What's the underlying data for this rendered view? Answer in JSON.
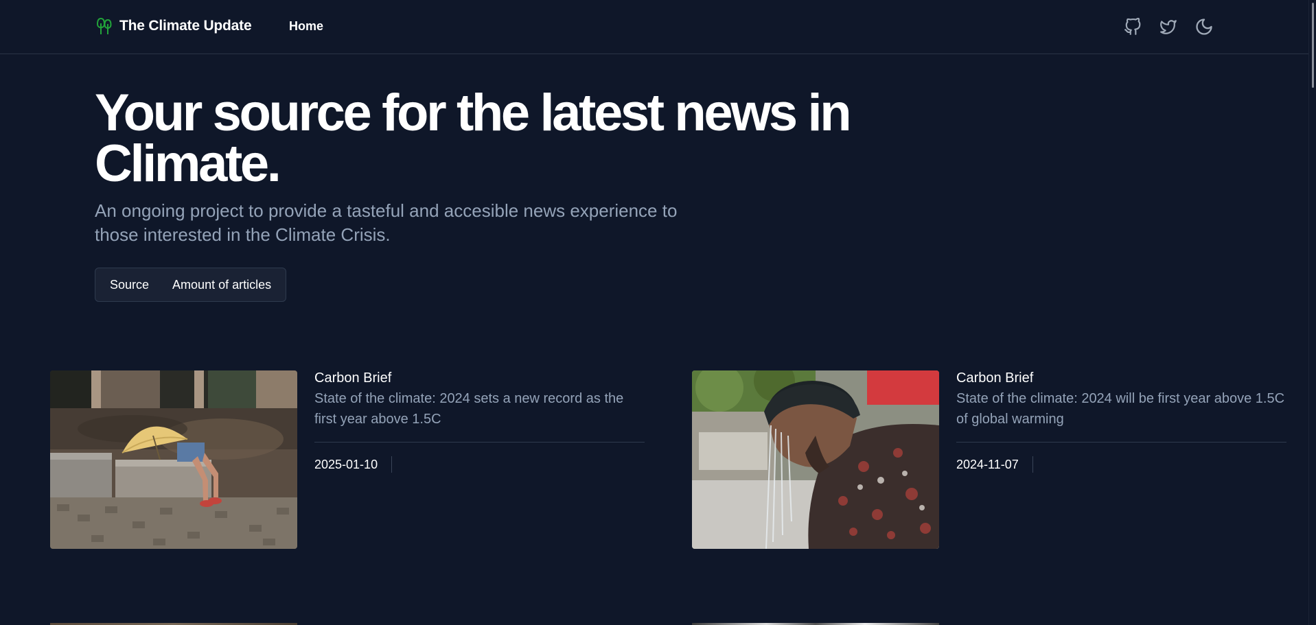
{
  "header": {
    "brand_title": "The Climate Update",
    "brand_icon": "tree-logo-icon",
    "nav": [
      {
        "label": "Home"
      }
    ],
    "actions": [
      {
        "icon": "github-icon"
      },
      {
        "icon": "twitter-icon"
      },
      {
        "icon": "moon-icon"
      }
    ]
  },
  "hero": {
    "title": "Your source for the latest news in Climate.",
    "subtitle": "An ongoing project to provide a tasteful and accesible news experience to those interested in the Climate Crisis."
  },
  "tabs": [
    {
      "label": "Source"
    },
    {
      "label": "Amount of articles"
    }
  ],
  "articles": [
    {
      "source": "Carbon Brief",
      "title": "State of the climate: 2024 sets a new record as the first year above 1.5C",
      "date": "2025-01-10",
      "image": "person-under-umbrella-heat-photo"
    },
    {
      "source": "Carbon Brief",
      "title": "State of the climate: 2024 will be first year above 1.5C of global warming",
      "date": "2024-11-07",
      "image": "man-cooling-head-under-fountain-photo"
    }
  ],
  "colors": {
    "background": "#0f1729",
    "brand_accent": "#22a33a",
    "muted_text": "#94a3b8",
    "border": "#2e3a4e"
  }
}
